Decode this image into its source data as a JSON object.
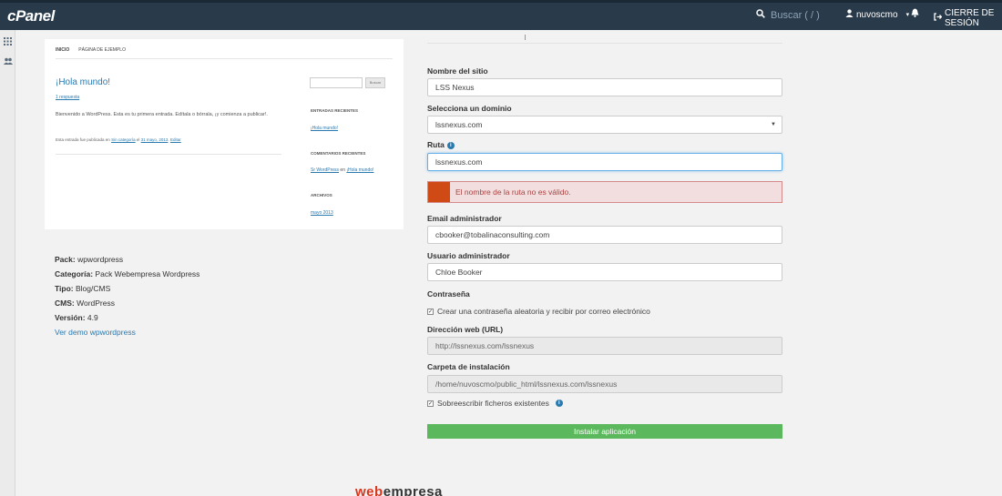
{
  "topbar": {
    "logo": "cPanel",
    "search_placeholder": "Buscar ( / )",
    "user": "nuvoscmo",
    "logout": "CIERRE DE SESIÓN"
  },
  "preview": {
    "nav": [
      "INICIO",
      "PÁGINA DE EJEMPLO"
    ],
    "post_title": "¡Hola mundo!",
    "replies": "1 respuesta",
    "body": "Bienvenido a WordPress. Esta es tu primera entrada. Edítala o bórrala, ¡y comienza a publicar!.",
    "footer_prefix": "Esta entrada fue publicada en",
    "footer_cat": "Sin categoría",
    "footer_mid": "el",
    "footer_date": "31 mayo, 2013",
    "footer_edit": "Editar",
    "search_btn": "Buscar",
    "recent_posts_head": "ENTRADAS RECIENTES",
    "recent_post": "¡Hola mundo!",
    "recent_comments_head": "COMENTARIOS RECIENTES",
    "recent_comment_author": "Sr WordPress",
    "recent_comment_on": "en",
    "recent_comment_post": "¡Hola mundo!",
    "archives_head": "ARCHIVOS",
    "archive": "mayo 2013"
  },
  "info": {
    "pack_label": "Pack:",
    "pack": "wpwordpress",
    "categoria_label": "Categoría:",
    "categoria": "Pack Webempresa Wordpress",
    "tipo_label": "Tipo:",
    "tipo": "Blog/CMS",
    "cms_label": "CMS:",
    "cms": "WordPress",
    "version_label": "Versión:",
    "version": "4.9",
    "demo_link": "Ver demo wpwordpress"
  },
  "form": {
    "site_name_label": "Nombre del sitio",
    "site_name": "LSS Nexus",
    "domain_label": "Selecciona un dominio",
    "domain": "lssnexus.com",
    "path_label": "Ruta",
    "path": "lssnexus.com",
    "error": "El nombre de la ruta no es válido.",
    "email_label": "Email administrador",
    "email": "cbooker@tobalinaconsulting.com",
    "user_label": "Usuario administrador",
    "user": "Chloe Booker",
    "password_label": "Contraseña",
    "password_option": "Crear una contraseña aleatoria y recibir por correo electrónico",
    "url_label": "Dirección web (URL)",
    "url": "http://lssnexus.com/lssnexus",
    "folder_label": "Carpeta de instalación",
    "folder": "/home/nuvoscmo/public_html/lssnexus.com/lssnexus",
    "overwrite": "Sobreescribir ficheros existentes",
    "install_button": "Instalar aplicación"
  },
  "footer_brand": {
    "red": "web",
    "dark": "empresa"
  },
  "icons": [
    "search-icon",
    "user-icon",
    "caret-down-icon",
    "bell-icon",
    "logout-icon",
    "grid-icon",
    "users-icon",
    "info-icon",
    "checkbox-icon"
  ],
  "colors": {
    "topbar": "#293a4a",
    "link": "#2a7ab0",
    "error_bar": "#d04a16",
    "error_bg": "#f2dede",
    "install": "#5cb85c"
  }
}
